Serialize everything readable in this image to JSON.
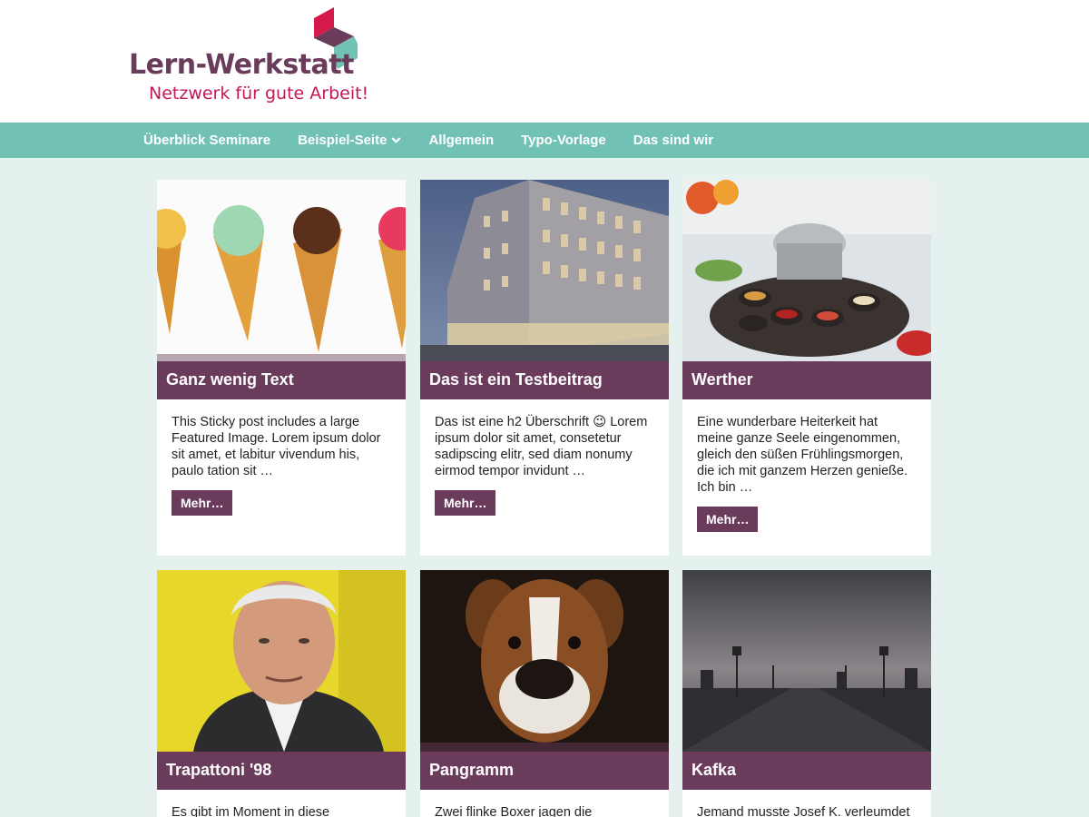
{
  "header": {
    "logo_title": "Lern-Werkstatt",
    "logo_tagline": "Netzwerk für gute Arbeit!",
    "brand_colors": {
      "purple": "#6b3b5c",
      "crimson": "#c3185a",
      "teal": "#72c1b5"
    }
  },
  "nav": {
    "items": [
      {
        "label": "Überblick Seminare"
      },
      {
        "label": "Beispiel-Seite",
        "icon": "chevron-down-icon"
      },
      {
        "label": "Allgemein"
      },
      {
        "label": "Typo-Vorlage"
      },
      {
        "label": "Das sind wir"
      }
    ]
  },
  "posts": [
    {
      "title": "Ganz wenig Text",
      "excerpt": "This Sticky post includes a large Featured Image. Lorem ipsum dolor sit amet, et labitur vivendum his, paulo tation sit …",
      "more": "Mehr…",
      "image": "ice-cream-cones"
    },
    {
      "title": "Das ist ein Testbeitrag",
      "excerpt": "Das ist eine h2 Überschrift 😉 Lorem ipsum dolor sit amet, consetetur sadipscing elitr, sed diam nonumy eirmod tempor invidunt …",
      "more": "Mehr…",
      "image": "modern-building"
    },
    {
      "title": "Werther",
      "excerpt": "Eine wunderbare Heiterkeit hat meine ganze Seele eingenommen, gleich den süßen Frühlingsmorgen, die ich mit ganzem Herzen genieße. Ich bin …",
      "more": "Mehr…",
      "image": "fondue-table"
    },
    {
      "title": "Trapattoni '98",
      "excerpt": "Es gibt im Moment in diese",
      "image": "portrait-man"
    },
    {
      "title": "Pangramm",
      "excerpt": "Zwei flinke Boxer jagen die",
      "image": "boxer-dog"
    },
    {
      "title": "Kafka",
      "excerpt": "Jemand musste Josef K. verleumdet",
      "image": "foggy-bridge"
    }
  ]
}
